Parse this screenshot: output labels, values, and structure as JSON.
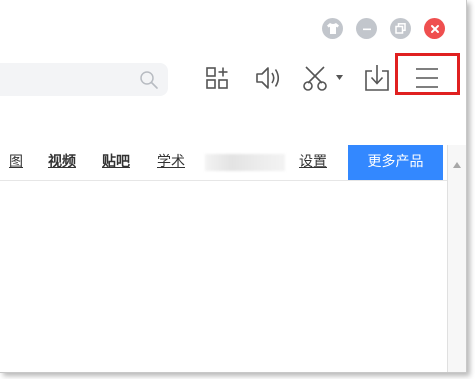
{
  "window_controls": {
    "skin_icon": "tshirt-icon",
    "minimize_icon": "minimize-icon",
    "restore_icon": "restore-icon",
    "close_icon": "close-icon",
    "colors": {
      "gray": "#c2c6cc",
      "close": "#ef4f4f"
    }
  },
  "toolbar": {
    "search_icon": "search-icon",
    "icons": [
      "apps-add-icon",
      "speaker-icon",
      "scissors-icon",
      "download-icon",
      "menu-icon"
    ],
    "highlight_color": "#e02020"
  },
  "nav": {
    "items": [
      {
        "label": "图",
        "bold": false
      },
      {
        "label": "视频",
        "bold": true
      },
      {
        "label": "贴吧",
        "bold": true
      },
      {
        "label": "学术",
        "bold": false
      },
      {
        "label": "设置",
        "bold": false
      }
    ],
    "more_label": "更多产品",
    "accent": "#3388ff"
  }
}
